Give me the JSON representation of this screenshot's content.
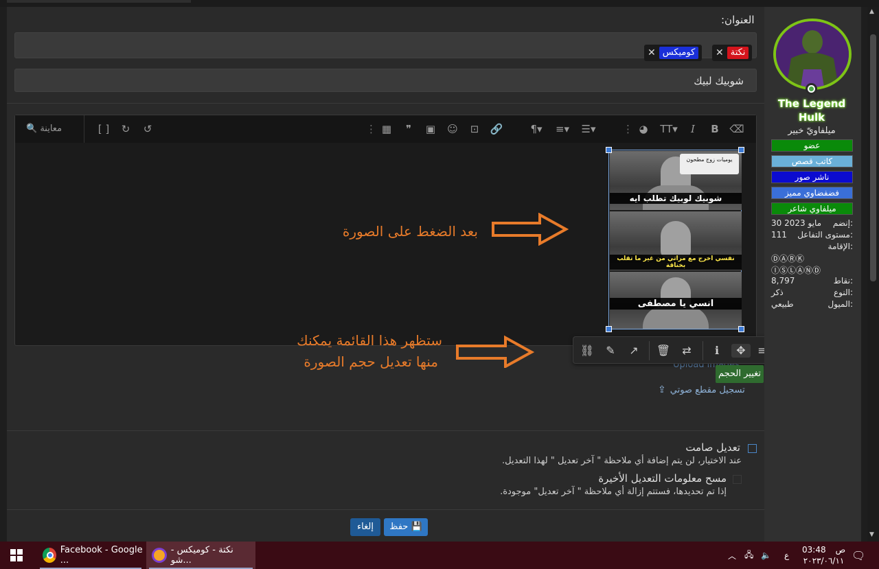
{
  "form": {
    "title_label": "العنوان:",
    "tags": [
      {
        "label": "نكتة",
        "color": "#d4141c"
      },
      {
        "label": "كوميكس",
        "color": "#1a2fd8"
      }
    ],
    "title_value": "شوبيك لبيك"
  },
  "toolbar": {
    "preview_label": "معاينة",
    "icons": [
      "eraser-icon",
      "bold-icon",
      "italic-icon",
      "text-size-icon",
      "palette-icon",
      "link-icon",
      "image-icon",
      "smilie-icon",
      "media-icon",
      "quote-icon",
      "table-icon",
      "list-icon",
      "align-icon",
      "paragraph-icon",
      "undo-icon",
      "redo-icon",
      "toggle-bbcode-icon"
    ]
  },
  "meme": {
    "captions": [
      "شوبيك لوبيك تطلب ايه",
      "نفسي اخرج مع مراتي من غير ما تقلب بخناقة",
      "انسي يا مصطفى"
    ],
    "watermark": "يوميات زوج مطحون"
  },
  "annotations": {
    "arrow1_text": "بعد الضغط على الصورة",
    "arrow2_line1": "ستظهر هذا القائمة يمكنك",
    "arrow2_line2": "منها تعديل حجم الصورة",
    "color": "#e87b2a"
  },
  "image_menu": {
    "tooltip": "تغيير الحجم",
    "icons": [
      "align-menu-icon",
      "move-resize-icon",
      "alt-text-icon",
      "replace-icon",
      "delete-icon",
      "open-link-icon",
      "edit-icon",
      "unlink-icon"
    ]
  },
  "attachments": {
    "upload_label": "Upload images",
    "voice_label": "تسجيل مقطع صوتي"
  },
  "options": {
    "silent_label": "تعديل صامت",
    "silent_desc": "عند الاختيار، لن يتم إضافة أي ملاحظة \" آخر تعديل \" لهذا التعديل.",
    "clear_label": "مسح معلومات التعديل الأخيرة",
    "clear_desc": "إذا تم تحديدها، فستتم إزالة أي ملاحظة \" آخر تعديل\" موجودة."
  },
  "buttons": {
    "save_label": "حفظ",
    "cancel_label": "إلغاء",
    "save_color": "#2f77c4",
    "cancel_color": "#1f5a96"
  },
  "user": {
    "name_line1": "The Legend",
    "name_line2": "Hulk",
    "title": "ميلفاويّ خبير",
    "badges": [
      {
        "label": "عضو",
        "color": "#0a8a0a"
      },
      {
        "label": "كاتب قصص",
        "color": "#6ab0d8"
      },
      {
        "label": "ناشر صور",
        "color": "#0b0bd0"
      },
      {
        "label": "فضفضاوي مميز",
        "color": "#3a6fd8"
      },
      {
        "label": "ميلفاوي شاعر",
        "color": "#0a8a0a"
      }
    ],
    "stats": [
      {
        "label": "إنضم:",
        "value": "30 مايو 2023"
      },
      {
        "label": "مستوى التفاعل:",
        "value": "111"
      },
      {
        "label": "الإقامة:",
        "value": ""
      },
      {
        "label": "",
        "value": "ⒹⒶⓇⓀ"
      },
      {
        "label": "",
        "value": "ⒾⓈⓁⒶⓃⒹ"
      },
      {
        "label": "نقاط:",
        "value": "8,797"
      },
      {
        "label": "النوع:",
        "value": "ذكر"
      },
      {
        "label": "الميول:",
        "value": "طبيعي"
      }
    ]
  },
  "taskbar": {
    "items": [
      {
        "label": "Facebook - Google ...",
        "icon": "chrome-icon"
      },
      {
        "label": "نكتة - كوميكس - شو...",
        "icon": "browser-icon"
      }
    ],
    "time": "03:48",
    "ampm": "ص",
    "date": "٢٠٢٣/٠٦/١١",
    "lang": "ع"
  }
}
